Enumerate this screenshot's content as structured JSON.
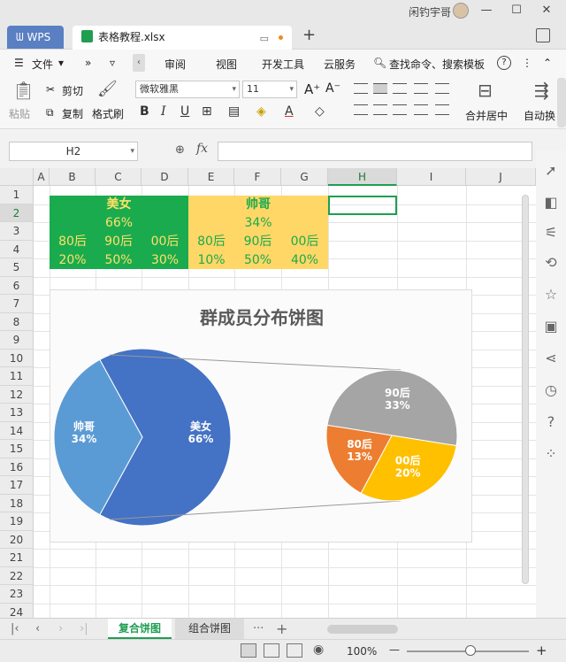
{
  "titlebar": {
    "user": "闲钓宇哥",
    "minimize": "—",
    "maximize": "☐",
    "close": "✕"
  },
  "tabs": {
    "wps": "WPS",
    "file": "表格教程.xlsx",
    "add": "+"
  },
  "menu": {
    "file": "文件",
    "more": "»",
    "items": [
      "审阅",
      "视图",
      "开发工具",
      "云服务"
    ],
    "search": "查找命令、搜索模板",
    "help": "?",
    "more_dots": "⋮",
    "up": "⌃"
  },
  "ribbon": {
    "paste": "粘贴",
    "cut": "剪切",
    "copy": "复制",
    "format_painter": "格式刷",
    "font_name": "微软雅黑",
    "font_size": "11",
    "merge_center": "合并居中",
    "auto_wrap": "自动换"
  },
  "formula_bar": {
    "name_box": "H2",
    "fx": "fx",
    "content": ""
  },
  "columns": [
    "A",
    "B",
    "C",
    "D",
    "E",
    "F",
    "G",
    "H",
    "I",
    "J"
  ],
  "active_column": "H",
  "rows": [
    "1",
    "2",
    "3",
    "4",
    "5",
    "6",
    "7",
    "8",
    "9",
    "10",
    "11",
    "12",
    "13",
    "14",
    "15",
    "16",
    "17",
    "18",
    "19",
    "20",
    "21",
    "22",
    "23",
    "24"
  ],
  "active_row": "2",
  "table": {
    "female_label": "美女",
    "male_label": "帅哥",
    "female_pct": "66%",
    "male_pct": "34%",
    "age_groups": [
      "80后",
      "90后",
      "00后",
      "80后",
      "90后",
      "00后"
    ],
    "age_pcts": [
      "20%",
      "50%",
      "30%",
      "10%",
      "50%",
      "40%"
    ]
  },
  "chart_data": {
    "type": "pie",
    "title": "群成员分布饼图",
    "main": {
      "slices": [
        {
          "name": "美女",
          "value": 66,
          "label": "66%",
          "color": "#4472c4"
        },
        {
          "name": "帅哥",
          "value": 34,
          "label": "34%",
          "color": "#5b9bd5"
        }
      ]
    },
    "secondary": {
      "slices": [
        {
          "name": "90后",
          "value": 33,
          "label": "33%",
          "color": "#a5a5a5"
        },
        {
          "name": "00后",
          "value": 20,
          "label": "20%",
          "color": "#ffc000"
        },
        {
          "name": "80后",
          "value": 13,
          "label": "13%",
          "color": "#ed7d31"
        }
      ]
    }
  },
  "sheet_tabs": {
    "active": "复合饼图",
    "other": "组合饼图",
    "more": "···",
    "add": "+"
  },
  "statusbar": {
    "zoom": "100%",
    "minus": "—",
    "plus": "+"
  },
  "colors": {
    "green": "#1aab4e",
    "yellow": "#ffd767",
    "accent": "#1f9e52"
  }
}
